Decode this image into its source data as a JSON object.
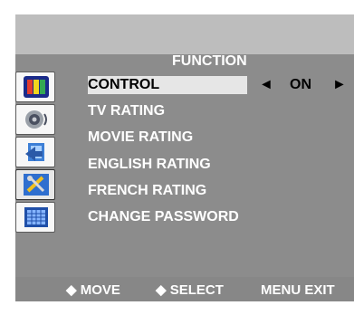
{
  "header": {
    "title": "FUNCTION"
  },
  "sidebar": {
    "icons": [
      {
        "name": "picture-icon"
      },
      {
        "name": "sound-icon"
      },
      {
        "name": "setup-icon"
      },
      {
        "name": "function-icon"
      },
      {
        "name": "channel-icon"
      }
    ]
  },
  "menu": {
    "items": [
      {
        "label": "CONTROL"
      },
      {
        "label": "TV RATING"
      },
      {
        "label": "MOVIE RATING"
      },
      {
        "label": "ENGLISH RATING"
      },
      {
        "label": "FRENCH RATING"
      },
      {
        "label": "CHANGE PASSWORD"
      }
    ],
    "selected_value": "ON",
    "left_arrow": "◄",
    "right_arrow": "►"
  },
  "footer": {
    "move": "◆ MOVE",
    "select": "◆ SELECT",
    "exit": "MENU  EXIT"
  }
}
